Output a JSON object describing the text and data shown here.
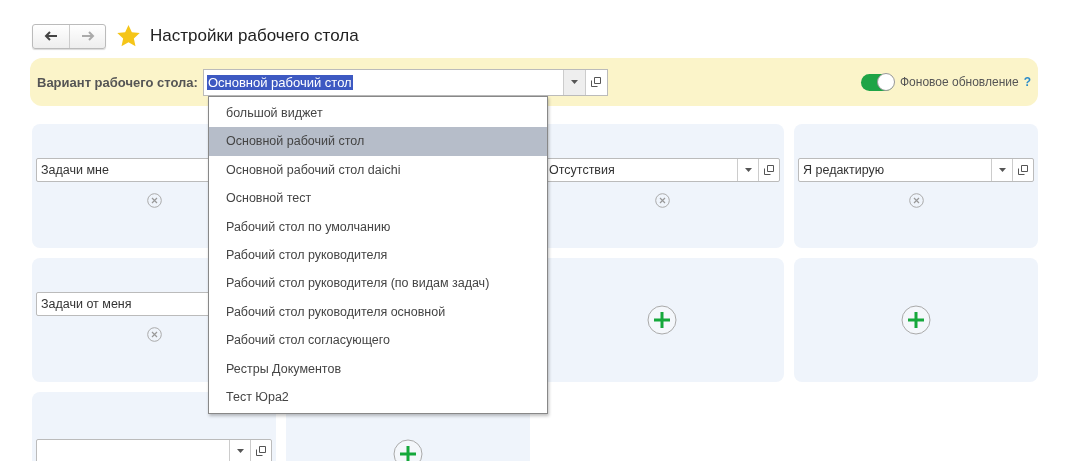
{
  "nav": [
    {
      "kind": "back",
      "disabled": false
    },
    {
      "kind": "forward",
      "disabled": true
    }
  ],
  "title": "Настройки рабочего стола",
  "favorite": true,
  "variant": {
    "label": "Вариант рабочего стола:",
    "value": "Основной рабочий стол",
    "expanded": true,
    "options": [
      {
        "label": "большой виджет",
        "selected": false
      },
      {
        "label": "Основной рабочий стол",
        "selected": true
      },
      {
        "label": "Основной рабочий стол daichi",
        "selected": false
      },
      {
        "label": "Основной тест",
        "selected": false
      },
      {
        "label": "Рабочий стол по умолчанию",
        "selected": false
      },
      {
        "label": "Рабочий стол руководителя",
        "selected": false
      },
      {
        "label": "Рабочий стол руководителя (по видам задач)",
        "selected": false
      },
      {
        "label": "Рабочий стол руководителя основной",
        "selected": false
      },
      {
        "label": "Рабочий стол согласующего",
        "selected": false
      },
      {
        "label": "Рестры Документов",
        "selected": false
      },
      {
        "label": "Тест Юра2",
        "selected": false
      }
    ]
  },
  "background_update": {
    "label": "Фоновое обновление",
    "on": true,
    "help": "?"
  },
  "widgets": [
    {
      "kind": "widget",
      "value": "Задачи мне"
    },
    {
      "kind": "widget",
      "value": "Отсутствия"
    },
    {
      "kind": "widget",
      "value": "Я редактирую"
    },
    {
      "kind": "widget",
      "value": "Задачи от меня"
    },
    {
      "kind": "empty"
    },
    {
      "kind": "empty"
    },
    {
      "kind": "widget"
    },
    {
      "kind": "empty"
    }
  ]
}
